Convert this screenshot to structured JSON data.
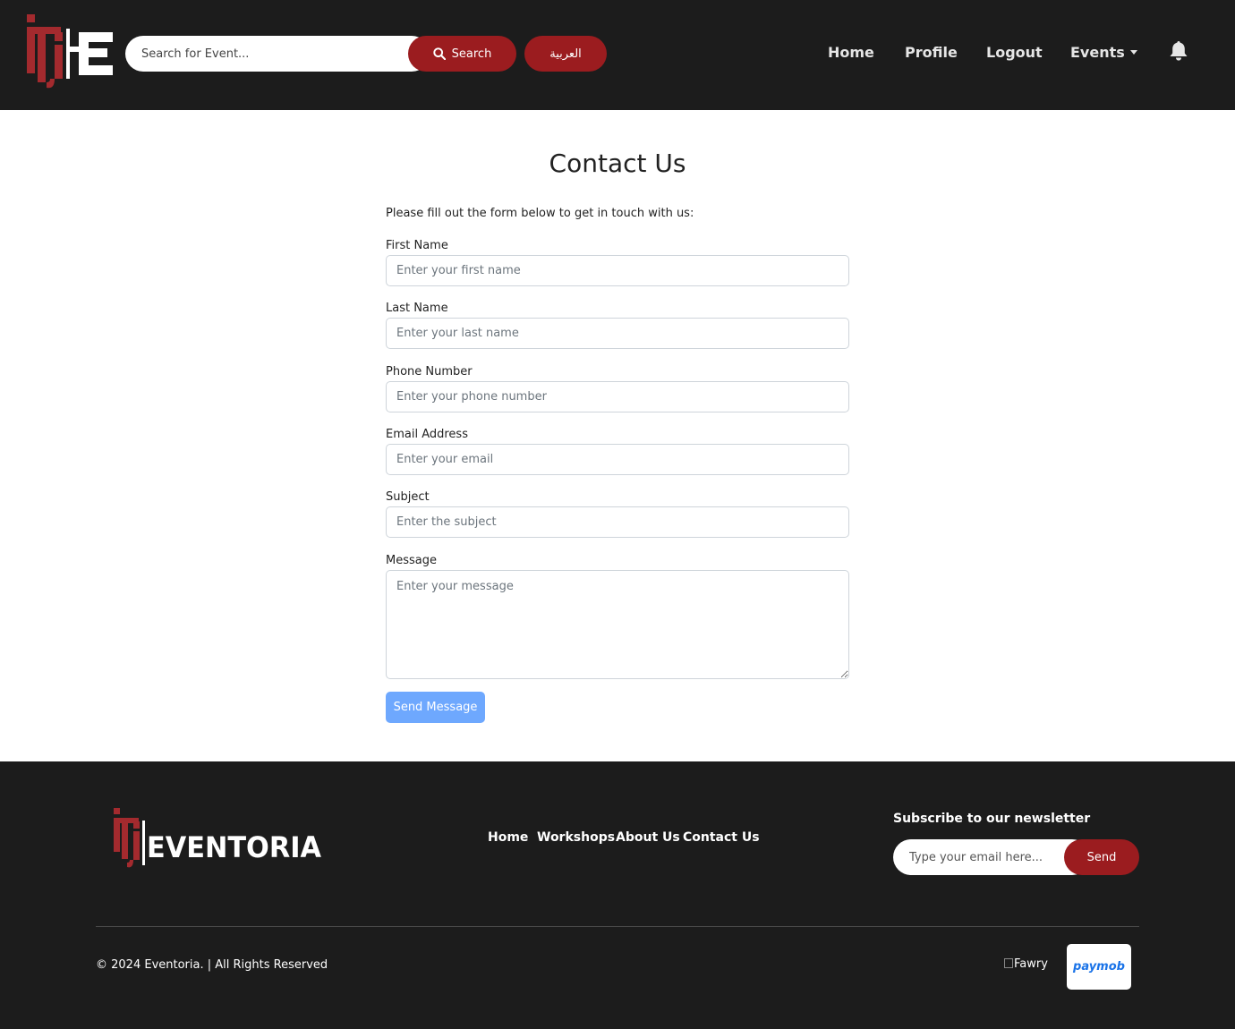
{
  "header": {
    "logo_text": "ITI E",
    "search": {
      "placeholder": "Search for Event...",
      "value": "",
      "button_label": "Search"
    },
    "language_button": "العربية",
    "nav": {
      "home": "Home",
      "profile": "Profile",
      "logout": "Logout",
      "events": "Events"
    },
    "icons": {
      "search": "search-icon",
      "notifications": "bell-icon",
      "dropdown": "caret-down-icon"
    }
  },
  "main": {
    "title": "Contact Us",
    "intro": "Please fill out the form below to get in touch with us:",
    "fields": {
      "first_name": {
        "label": "First Name",
        "placeholder": "Enter your first name",
        "value": ""
      },
      "last_name": {
        "label": "Last Name",
        "placeholder": "Enter your last name",
        "value": ""
      },
      "phone": {
        "label": "Phone Number",
        "placeholder": "Enter your phone number",
        "value": ""
      },
      "email": {
        "label": "Email Address",
        "placeholder": "Enter your email",
        "value": ""
      },
      "subject": {
        "label": "Subject",
        "placeholder": "Enter the subject",
        "value": ""
      },
      "message": {
        "label": "Message",
        "placeholder": "Enter your message",
        "value": ""
      }
    },
    "submit_label": "Send Message"
  },
  "footer": {
    "logo_text": "ITI EVENTORIA",
    "links": {
      "home": "Home",
      "workshops": "Workshops",
      "about": "About Us",
      "contact": "Contact Us"
    },
    "newsletter": {
      "title": "Subscribe to our newsletter",
      "placeholder": "Type your email here...",
      "value": "",
      "button_label": "Send"
    },
    "copyright": "© 2024 Eventoria. | All Rights Reserved",
    "payments": {
      "fawry_alt": "Fawry",
      "paymob": "paymob"
    }
  },
  "colors": {
    "navbar_bg": "#1c1c1c",
    "brand_red": "#9b1c1f",
    "submit_button": "#6ea8fe",
    "page_bg": "#ffffff",
    "logo_red": "#a32a2e"
  }
}
